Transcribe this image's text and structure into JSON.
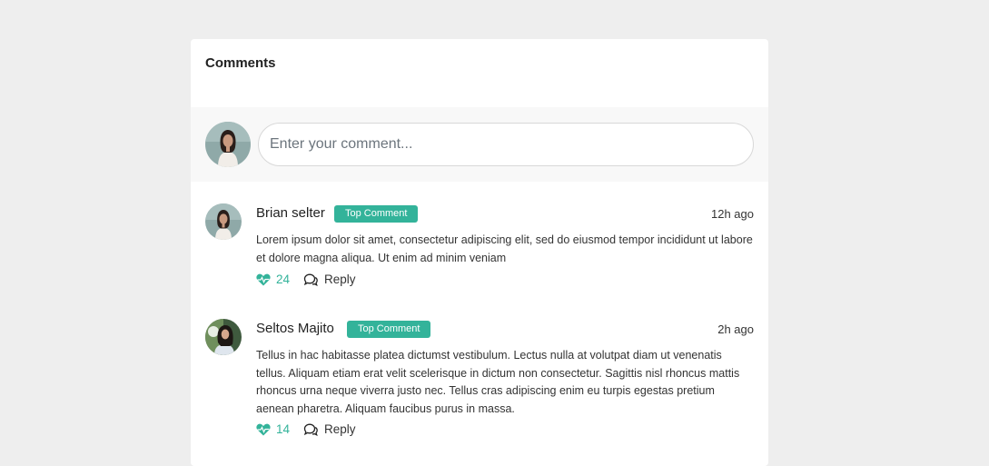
{
  "card": {
    "title": "Comments"
  },
  "composer": {
    "placeholder": "Enter your comment..."
  },
  "comments": [
    {
      "author": "Brian selter",
      "badge": "Top Comment",
      "time": "12h ago",
      "text": "Lorem ipsum dolor sit amet, consectetur adipiscing elit, sed do eiusmod tempor incididunt ut labore et dolore magna aliqua. Ut enim ad minim veniam",
      "likes": "24",
      "reply_label": "Reply"
    },
    {
      "author": "Seltos Majito",
      "badge": "Top Comment",
      "time": "2h ago",
      "text": "Tellus in hac habitasse platea dictumst vestibulum. Lectus nulla at volutpat diam ut venenatis tellus. Aliquam etiam erat velit scelerisque in dictum non consectetur. Sagittis nisl rhoncus mattis rhoncus urna neque viverra justo nec. Tellus cras adipiscing enim eu turpis egestas pretium aenean pharetra. Aliquam faucibus purus in massa.",
      "likes": "14",
      "reply_label": "Reply"
    }
  ],
  "icons": {
    "like": "heart-pulse-icon",
    "reply": "chat-bubbles-icon"
  },
  "colors": {
    "accent": "#33b39a",
    "background": "#eeeeee",
    "composer_bg": "#f8f8f8"
  }
}
